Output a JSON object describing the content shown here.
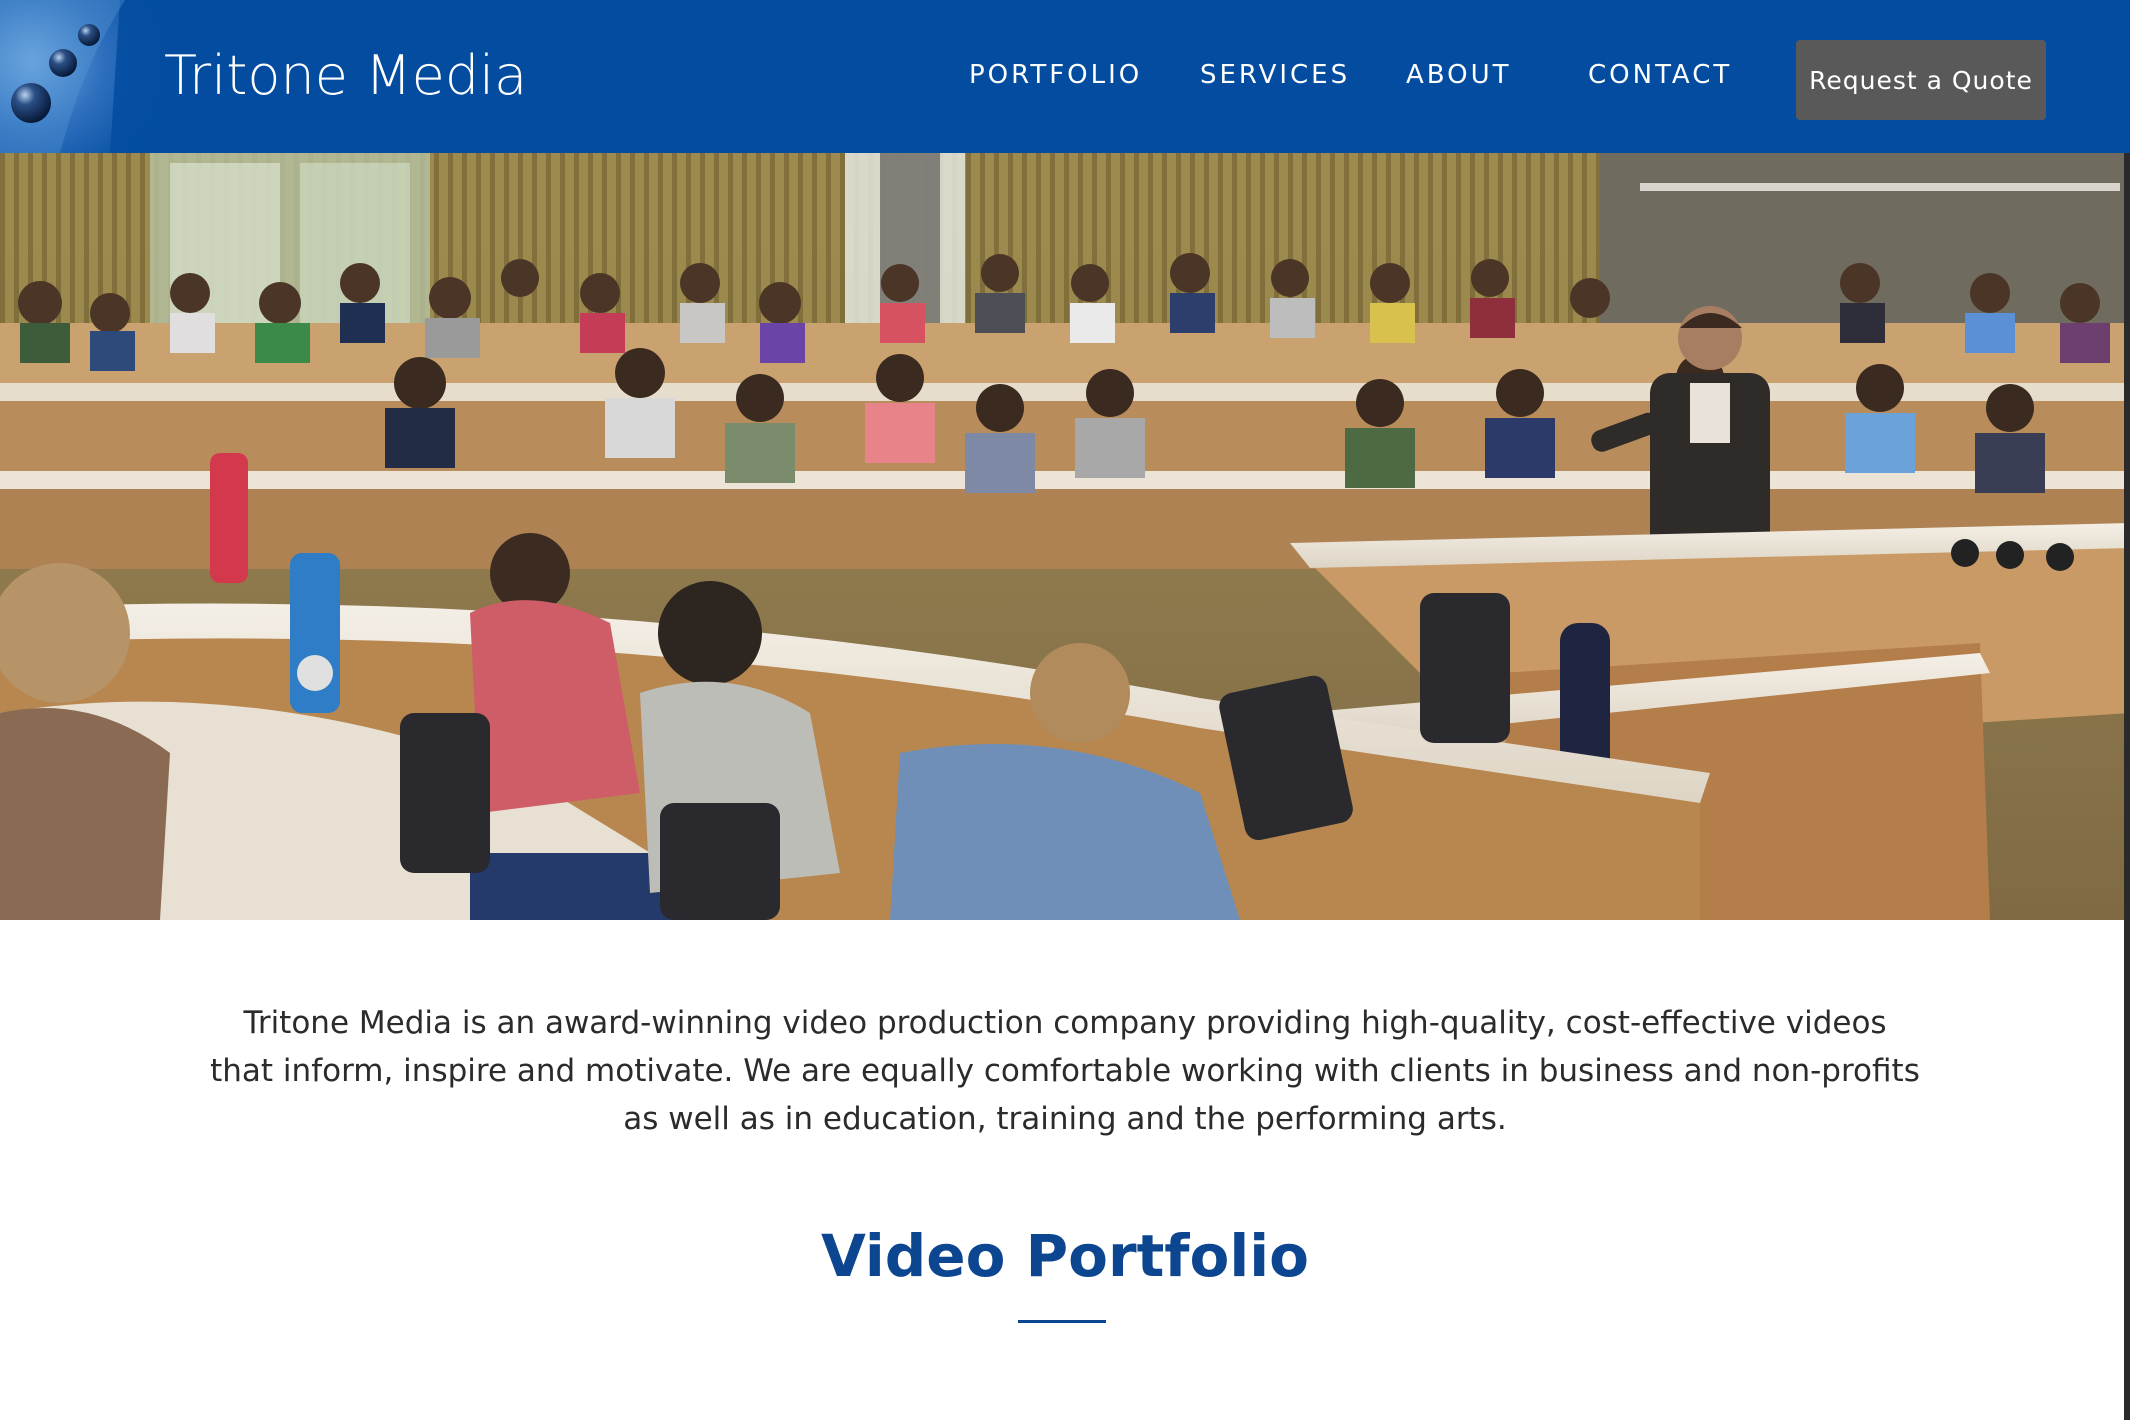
{
  "header": {
    "brand": "Tritone Media",
    "nav": {
      "portfolio": "PORTFOLIO",
      "services": "SERVICES",
      "about": "ABOUT",
      "contact": "CONTACT"
    },
    "cta_label": "Request a Quote",
    "colors": {
      "bar": "#034ca0",
      "cta": "#595959"
    }
  },
  "hero": {
    "icon": "classroom-lecture-photo"
  },
  "intro": {
    "text": "Tritone Media is an award-winning video production company providing high-quality, cost-effective videos that inform, inspire and motivate. We are equally comfortable working with clients in business and non-profits as well as in education, training and the performing arts."
  },
  "portfolio_section": {
    "title": "Video Portfolio",
    "accent": "#0c4690"
  }
}
